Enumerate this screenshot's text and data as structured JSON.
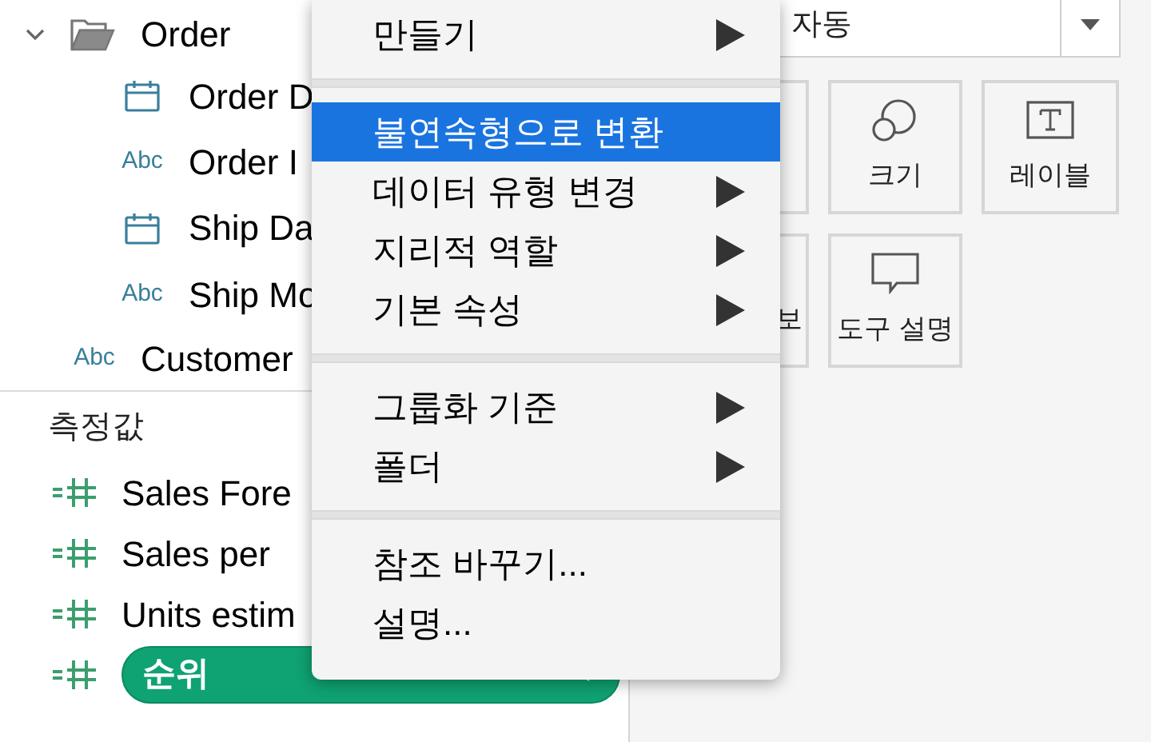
{
  "data_pane": {
    "folder": {
      "label": "Order",
      "expanded": true,
      "children": [
        {
          "kind": "date",
          "label": "Order D"
        },
        {
          "kind": "string",
          "type_text": "Abc",
          "label": "Order I"
        },
        {
          "kind": "date",
          "label": "Ship Da"
        },
        {
          "kind": "string",
          "type_text": "Abc",
          "label": "Ship Mo"
        }
      ]
    },
    "next_item": {
      "kind": "string",
      "type_text": "Abc",
      "label": "Customer"
    },
    "measures_header": "측정값",
    "measures": [
      {
        "label": "Sales Fore",
        "selected": false
      },
      {
        "label": "Sales per",
        "selected": false
      },
      {
        "label": "Units estim",
        "selected": false
      },
      {
        "label": "순위",
        "selected": true
      }
    ]
  },
  "marks_card": {
    "mark_type": "자동",
    "cards": [
      {
        "kind": "covered"
      },
      {
        "kind": "size",
        "label": "크기"
      },
      {
        "kind": "label",
        "label": "레이블"
      },
      {
        "kind": "covered",
        "label": "보"
      },
      {
        "kind": "tooltip",
        "label": "도구 설명"
      }
    ]
  },
  "context_menu": {
    "items": [
      {
        "kind": "item",
        "label": "만들기",
        "submenu": true,
        "highlighted": false
      },
      {
        "kind": "separator"
      },
      {
        "kind": "item",
        "label": "불연속형으로 변환",
        "submenu": false,
        "highlighted": true
      },
      {
        "kind": "item",
        "label": "데이터 유형 변경",
        "submenu": true,
        "highlighted": false
      },
      {
        "kind": "item",
        "label": "지리적 역할",
        "submenu": true,
        "highlighted": false
      },
      {
        "kind": "item",
        "label": "기본 속성",
        "submenu": true,
        "highlighted": false
      },
      {
        "kind": "separator"
      },
      {
        "kind": "item",
        "label": "그룹화 기준",
        "submenu": true,
        "highlighted": false
      },
      {
        "kind": "item",
        "label": "폴더",
        "submenu": true,
        "highlighted": false
      },
      {
        "kind": "separator"
      },
      {
        "kind": "item",
        "label": "참조 바꾸기...",
        "submenu": false,
        "highlighted": false
      },
      {
        "kind": "item",
        "label": "설명...",
        "submenu": false,
        "highlighted": false
      }
    ]
  }
}
